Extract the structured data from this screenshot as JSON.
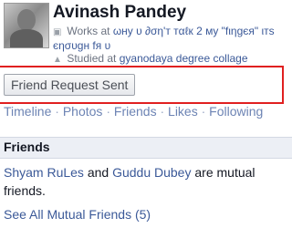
{
  "profile": {
    "name": "Avinash Pandey",
    "works_prefix": "Works at",
    "works_value": "ωнy υ ∂ση'т тαℓк 2 мy \"fιηgєя\" ιтѕ єησυgн fя υ",
    "studied_prefix": "Studied at",
    "studied_value": "gyanodaya degree collage"
  },
  "actions": {
    "friend_request_label": "Friend Request Sent"
  },
  "tabs": {
    "items": [
      "Timeline",
      "Photos",
      "Friends",
      "Likes",
      "Following"
    ],
    "separator": "·"
  },
  "friends_section": {
    "title": "Friends",
    "mutual_friend_1": "Shyam RuLes",
    "and_text": "and",
    "mutual_friend_2": "Guddu Dubey",
    "suffix_text": "are mutual friends.",
    "see_all_label": "See All Mutual Friends (5)"
  },
  "icons": {
    "work": "briefcase-icon",
    "education": "graduation-cap-icon"
  }
}
